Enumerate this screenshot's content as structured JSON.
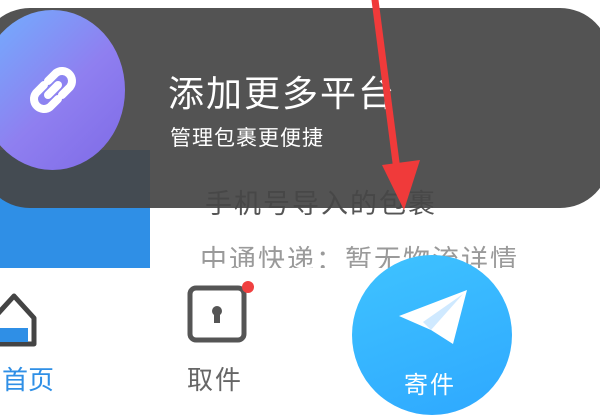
{
  "toast": {
    "title": "添加更多平台",
    "subtitle": "管理包裹更便捷",
    "icon": "link-icon"
  },
  "content": {
    "package_title": "手机号导入的包裹",
    "package_status": "中通快递：暂无物流详情"
  },
  "tabbar": {
    "home_label": "首页",
    "pickup_label": "取件",
    "send_label": "寄件"
  },
  "colors": {
    "accent": "#2f8fe6",
    "send_button": "#2ea8ff",
    "badge": "#f04040",
    "arrow": "#f03a3a"
  }
}
